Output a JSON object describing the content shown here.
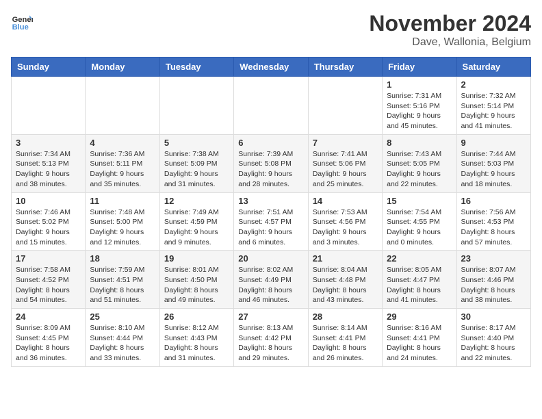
{
  "logo": {
    "general": "General",
    "blue": "Blue"
  },
  "title": {
    "month": "November 2024",
    "location": "Dave, Wallonia, Belgium"
  },
  "headers": [
    "Sunday",
    "Monday",
    "Tuesday",
    "Wednesday",
    "Thursday",
    "Friday",
    "Saturday"
  ],
  "weeks": [
    [
      {
        "day": "",
        "info": ""
      },
      {
        "day": "",
        "info": ""
      },
      {
        "day": "",
        "info": ""
      },
      {
        "day": "",
        "info": ""
      },
      {
        "day": "",
        "info": ""
      },
      {
        "day": "1",
        "info": "Sunrise: 7:31 AM\nSunset: 5:16 PM\nDaylight: 9 hours and 45 minutes."
      },
      {
        "day": "2",
        "info": "Sunrise: 7:32 AM\nSunset: 5:14 PM\nDaylight: 9 hours and 41 minutes."
      }
    ],
    [
      {
        "day": "3",
        "info": "Sunrise: 7:34 AM\nSunset: 5:13 PM\nDaylight: 9 hours and 38 minutes."
      },
      {
        "day": "4",
        "info": "Sunrise: 7:36 AM\nSunset: 5:11 PM\nDaylight: 9 hours and 35 minutes."
      },
      {
        "day": "5",
        "info": "Sunrise: 7:38 AM\nSunset: 5:09 PM\nDaylight: 9 hours and 31 minutes."
      },
      {
        "day": "6",
        "info": "Sunrise: 7:39 AM\nSunset: 5:08 PM\nDaylight: 9 hours and 28 minutes."
      },
      {
        "day": "7",
        "info": "Sunrise: 7:41 AM\nSunset: 5:06 PM\nDaylight: 9 hours and 25 minutes."
      },
      {
        "day": "8",
        "info": "Sunrise: 7:43 AM\nSunset: 5:05 PM\nDaylight: 9 hours and 22 minutes."
      },
      {
        "day": "9",
        "info": "Sunrise: 7:44 AM\nSunset: 5:03 PM\nDaylight: 9 hours and 18 minutes."
      }
    ],
    [
      {
        "day": "10",
        "info": "Sunrise: 7:46 AM\nSunset: 5:02 PM\nDaylight: 9 hours and 15 minutes."
      },
      {
        "day": "11",
        "info": "Sunrise: 7:48 AM\nSunset: 5:00 PM\nDaylight: 9 hours and 12 minutes."
      },
      {
        "day": "12",
        "info": "Sunrise: 7:49 AM\nSunset: 4:59 PM\nDaylight: 9 hours and 9 minutes."
      },
      {
        "day": "13",
        "info": "Sunrise: 7:51 AM\nSunset: 4:57 PM\nDaylight: 9 hours and 6 minutes."
      },
      {
        "day": "14",
        "info": "Sunrise: 7:53 AM\nSunset: 4:56 PM\nDaylight: 9 hours and 3 minutes."
      },
      {
        "day": "15",
        "info": "Sunrise: 7:54 AM\nSunset: 4:55 PM\nDaylight: 9 hours and 0 minutes."
      },
      {
        "day": "16",
        "info": "Sunrise: 7:56 AM\nSunset: 4:53 PM\nDaylight: 8 hours and 57 minutes."
      }
    ],
    [
      {
        "day": "17",
        "info": "Sunrise: 7:58 AM\nSunset: 4:52 PM\nDaylight: 8 hours and 54 minutes."
      },
      {
        "day": "18",
        "info": "Sunrise: 7:59 AM\nSunset: 4:51 PM\nDaylight: 8 hours and 51 minutes."
      },
      {
        "day": "19",
        "info": "Sunrise: 8:01 AM\nSunset: 4:50 PM\nDaylight: 8 hours and 49 minutes."
      },
      {
        "day": "20",
        "info": "Sunrise: 8:02 AM\nSunset: 4:49 PM\nDaylight: 8 hours and 46 minutes."
      },
      {
        "day": "21",
        "info": "Sunrise: 8:04 AM\nSunset: 4:48 PM\nDaylight: 8 hours and 43 minutes."
      },
      {
        "day": "22",
        "info": "Sunrise: 8:05 AM\nSunset: 4:47 PM\nDaylight: 8 hours and 41 minutes."
      },
      {
        "day": "23",
        "info": "Sunrise: 8:07 AM\nSunset: 4:46 PM\nDaylight: 8 hours and 38 minutes."
      }
    ],
    [
      {
        "day": "24",
        "info": "Sunrise: 8:09 AM\nSunset: 4:45 PM\nDaylight: 8 hours and 36 minutes."
      },
      {
        "day": "25",
        "info": "Sunrise: 8:10 AM\nSunset: 4:44 PM\nDaylight: 8 hours and 33 minutes."
      },
      {
        "day": "26",
        "info": "Sunrise: 8:12 AM\nSunset: 4:43 PM\nDaylight: 8 hours and 31 minutes."
      },
      {
        "day": "27",
        "info": "Sunrise: 8:13 AM\nSunset: 4:42 PM\nDaylight: 8 hours and 29 minutes."
      },
      {
        "day": "28",
        "info": "Sunrise: 8:14 AM\nSunset: 4:41 PM\nDaylight: 8 hours and 26 minutes."
      },
      {
        "day": "29",
        "info": "Sunrise: 8:16 AM\nSunset: 4:41 PM\nDaylight: 8 hours and 24 minutes."
      },
      {
        "day": "30",
        "info": "Sunrise: 8:17 AM\nSunset: 4:40 PM\nDaylight: 8 hours and 22 minutes."
      }
    ]
  ]
}
